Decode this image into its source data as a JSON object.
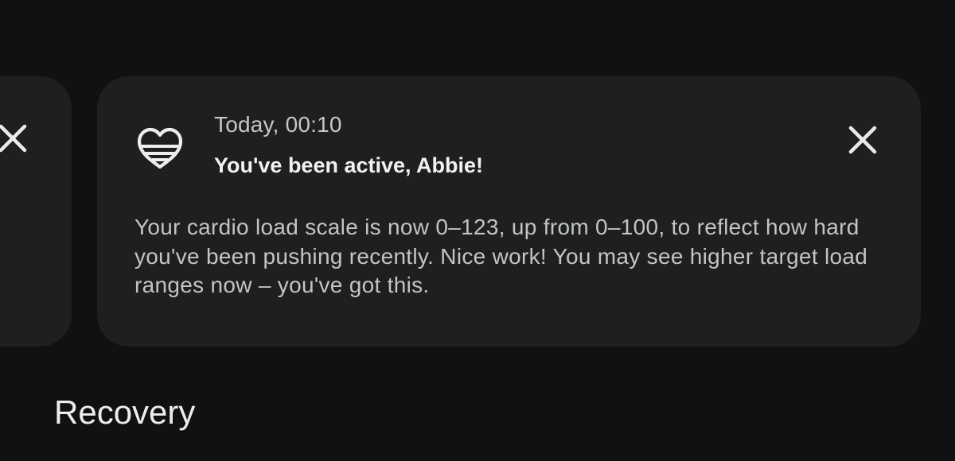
{
  "notification": {
    "timestamp": "Today, 00:10",
    "title": "You've been active, Abbie!",
    "body": "Your cardio load scale is now 0–123, up from 0–100, to reflect how hard you've been pushing recently. Nice work! You may see higher target load ranges now – you've got this.",
    "icon": "heart-icon",
    "dismiss_icon": "close-icon"
  },
  "left_card": {
    "dismiss_icon": "close-icon"
  },
  "section": {
    "title": "Recovery"
  },
  "colors": {
    "background": "#0f1112",
    "card": "#1e1f20",
    "primary_text": "#f1f2f2",
    "secondary_text": "#c3c5c5"
  }
}
